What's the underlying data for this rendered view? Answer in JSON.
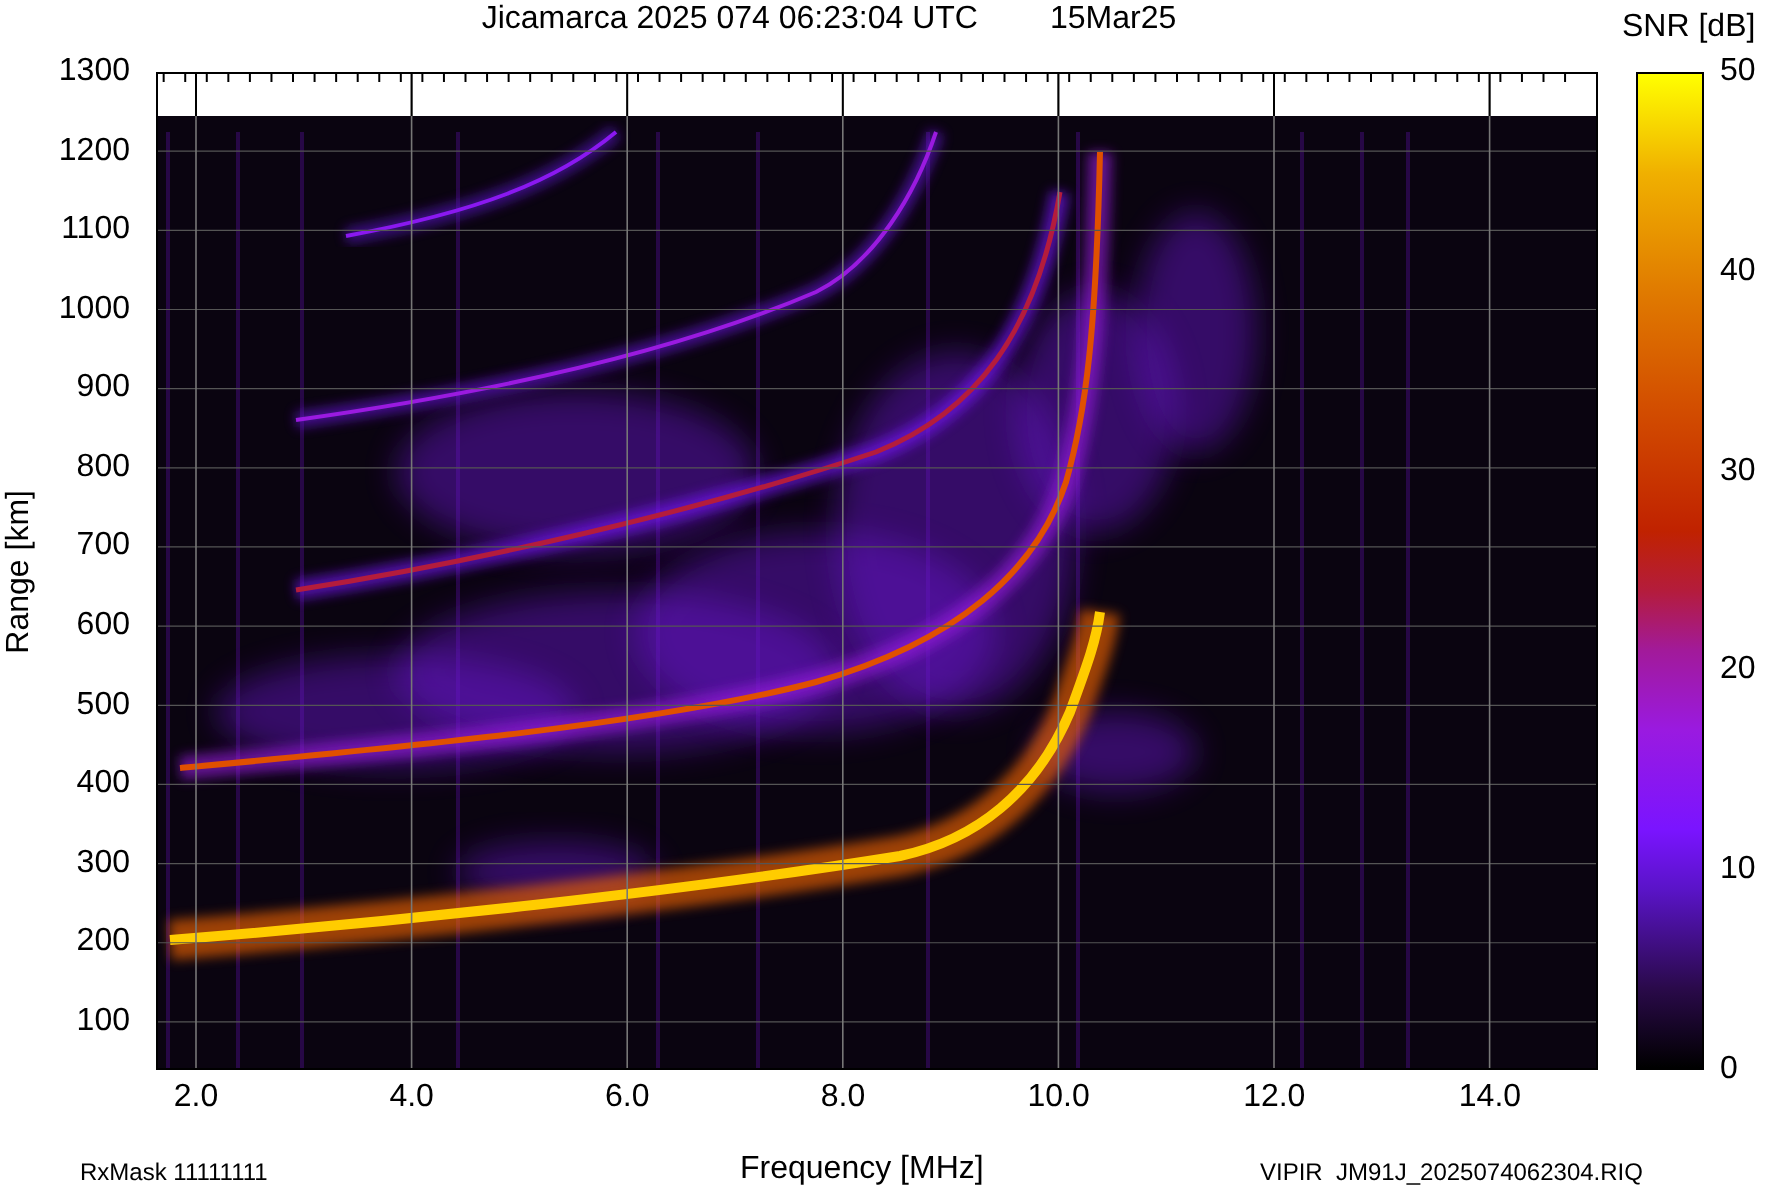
{
  "title": {
    "station_time": "Jicamarca 2025 074 06:23:04 UTC",
    "date": "15Mar25"
  },
  "y_axis": {
    "label": "Range [km]",
    "ticks": [
      "1300",
      "1200",
      "1100",
      "1000",
      "900",
      "800",
      "700",
      "600",
      "500",
      "400",
      "300",
      "200",
      "100"
    ]
  },
  "x_axis": {
    "label": "Frequency [MHz]",
    "ticks": [
      "2.0",
      "4.0",
      "6.0",
      "8.0",
      "10.0",
      "12.0",
      "14.0"
    ]
  },
  "colorbar": {
    "label": "SNR [dB]",
    "ticks": [
      "50",
      "40",
      "30",
      "20",
      "10",
      "0"
    ]
  },
  "footer": {
    "left": "RxMask 11111111",
    "right": "VIPIR  JM91J_2025074062304.RIQ"
  }
}
